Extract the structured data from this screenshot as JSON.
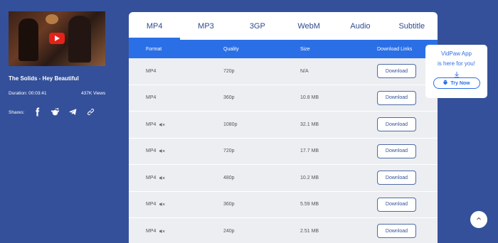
{
  "video": {
    "title": "The Solids - Hey Beautiful",
    "duration": "Duration: 00:03:41",
    "views": "437K Views"
  },
  "shares": {
    "label": "Shares:",
    "icons": [
      "facebook-icon",
      "reddit-icon",
      "telegram-icon",
      "link-icon"
    ]
  },
  "tabs": [
    {
      "label": "MP4",
      "active": true
    },
    {
      "label": "MP3",
      "active": false
    },
    {
      "label": "3GP",
      "active": false
    },
    {
      "label": "WebM",
      "active": false
    },
    {
      "label": "Audio",
      "active": false
    },
    {
      "label": "Subtitle",
      "active": false
    }
  ],
  "table": {
    "headers": [
      "Format",
      "Quality",
      "Size",
      "Download Links"
    ],
    "rows": [
      {
        "format": "MP4",
        "muted": false,
        "quality": "720p",
        "size": "N/A",
        "action": "Download"
      },
      {
        "format": "MP4",
        "muted": false,
        "quality": "360p",
        "size": "10.8 MB",
        "action": "Download"
      },
      {
        "format": "MP4",
        "muted": true,
        "quality": "1080p",
        "size": "32.1 MB",
        "action": "Download"
      },
      {
        "format": "MP4",
        "muted": true,
        "quality": "720p",
        "size": "17.7 MB",
        "action": "Download"
      },
      {
        "format": "MP4",
        "muted": true,
        "quality": "480p",
        "size": "10.2 MB",
        "action": "Download"
      },
      {
        "format": "MP4",
        "muted": true,
        "quality": "360p",
        "size": "5.59 MB",
        "action": "Download"
      },
      {
        "format": "MP4",
        "muted": true,
        "quality": "240p",
        "size": "2.51 MB",
        "action": "Download"
      }
    ]
  },
  "app_popup": {
    "title": "VidPaw App",
    "subtitle": "is here for you!",
    "button": "Try Now"
  },
  "colors": {
    "background": "#34509a",
    "accent": "#2b6fe6",
    "row_bg": "#eceef1"
  }
}
